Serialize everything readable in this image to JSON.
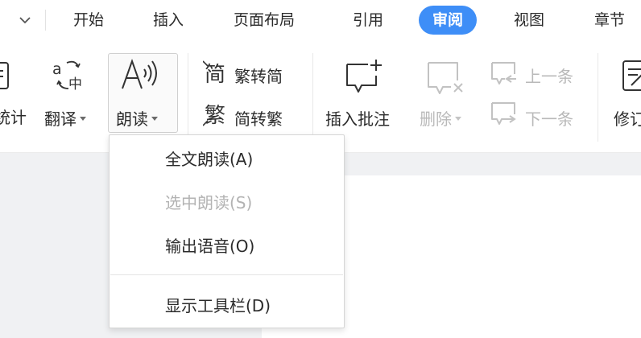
{
  "tabs": [
    {
      "label": "开始",
      "active": false
    },
    {
      "label": "插入",
      "active": false
    },
    {
      "label": "页面布局",
      "active": false
    },
    {
      "label": "引用",
      "active": false
    },
    {
      "label": "审阅",
      "active": true
    },
    {
      "label": "视图",
      "active": false
    },
    {
      "label": "章节",
      "active": false
    }
  ],
  "ribbon": {
    "stats_label": "统计",
    "translate_label": "翻译",
    "read_aloud_label": "朗读",
    "trad_to_simp_label": "繁转简",
    "simp_to_trad_label": "简转繁",
    "insert_comment_label": "插入批注",
    "delete_label": "删除",
    "prev_label": "上一条",
    "next_label": "下一条",
    "revise_label": "修订"
  },
  "read_menu": {
    "items": [
      {
        "label": "全文朗读(A)",
        "enabled": true
      },
      {
        "label": "选中朗读(S)",
        "enabled": false
      },
      {
        "label": "输出语音(O)",
        "enabled": true
      },
      {
        "label": "显示工具栏(D)",
        "enabled": true
      }
    ]
  },
  "colors": {
    "accent": "#3e8ef7",
    "text": "#2b2b2b",
    "disabled_text": "#b3b3b3",
    "document_background": "#f0f1f3"
  }
}
